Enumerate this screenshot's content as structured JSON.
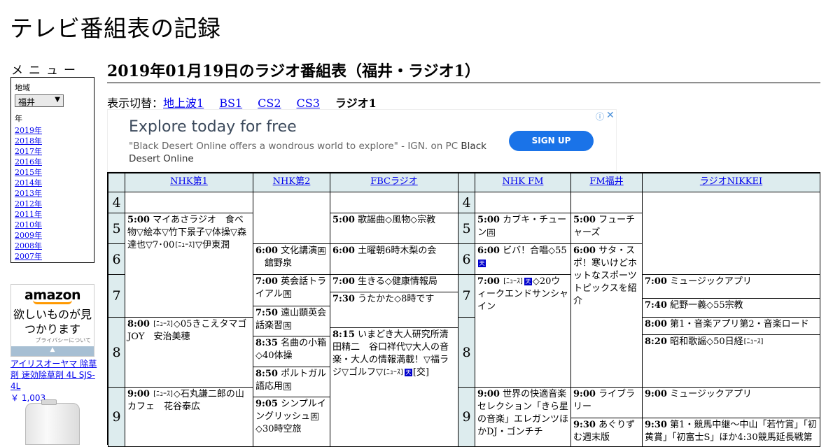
{
  "site_title": "テレビ番組表の記録",
  "menu": {
    "heading": "メニュー",
    "region_label": "地域",
    "region_value": "福井",
    "year_label": "年",
    "years": [
      "2019年",
      "2018年",
      "2017年",
      "2016年",
      "2015年",
      "2014年",
      "2013年",
      "2012年",
      "2011年",
      "2010年",
      "2009年",
      "2008年",
      "2007年"
    ]
  },
  "page_title": "2019年01月19日のラジオ番組表（福井・ラジオ1）",
  "switcher": {
    "label": "表示切替：",
    "links": [
      "地上波1",
      "BS1",
      "CS2",
      "CS3"
    ],
    "current": "ラジオ1"
  },
  "ad": {
    "headline": "Explore today for free",
    "body": "\"Black Desert Online offers a wondrous world to explore\" - IGN. on PC ",
    "advertiser": "Black Desert Online",
    "cta": "SIGN UP",
    "info_icon": "info-icon",
    "close_icon": "close-icon"
  },
  "amazon_ad": {
    "logo": "amazon",
    "message": "欲しいものが見つかります",
    "privacy": "プライバシーについて",
    "product": "アイリスオーヤマ 除草剤 速効除草剤 4L SJS-4L",
    "price": "￥ 1,003"
  },
  "channels": {
    "ch1": "NHK第1",
    "ch2": "NHK第2",
    "ch3": "FBCラジオ",
    "ch4": "NHK FM",
    "ch5": "FM福井",
    "ch6": "ラジオNIKKEI"
  },
  "hours": {
    "h4": "4",
    "h5": "5",
    "h6": "6",
    "h7": "7",
    "h8": "8",
    "h9": "9"
  },
  "programs": {
    "nhk1_0500": {
      "time": "5:00",
      "title": "マイあさラジオ　食べ物▽絵本▽竹下景子▽体操▽森達也▽7･00",
      "extra": "▽伊東潤"
    },
    "nhk1_0800": {
      "time": "8:00",
      "title": "◇05きこえタマゴJOY　安治美穂"
    },
    "nhk1_0900": {
      "time": "9:00",
      "title": "◇石丸謙二郎の山カフェ　花谷泰広"
    },
    "nhk2_0600": {
      "time": "6:00",
      "title": "文化講演",
      "extra": "舘野泉"
    },
    "nhk2_0700": {
      "time": "7:00",
      "title": "英会話トライアル"
    },
    "nhk2_0750": {
      "time": "7:50",
      "title": "遠山顕英会話楽習"
    },
    "nhk2_0835": {
      "time": "8:35",
      "title": "名曲の小箱◇40体操"
    },
    "nhk2_0850": {
      "time": "8:50",
      "title": "ポルトガル語応用"
    },
    "nhk2_0905": {
      "time": "9:05",
      "title": "シンプルイングリッシュ",
      "extra": "◇30時空旅"
    },
    "fbc_0500": {
      "time": "5:00",
      "title": "歌謡曲◇風物◇宗教"
    },
    "fbc_0600": {
      "time": "6:00",
      "title": "土曜朝6時木梨の会"
    },
    "fbc_0700": {
      "time": "7:00",
      "title": "生きる◇健康情報局"
    },
    "fbc_0730": {
      "time": "7:30",
      "title": "うたかた◇8時です"
    },
    "fbc_0815": {
      "time": "8:15",
      "title": "いまどき大人研究所清田精二　谷口祥代▽大人の音楽・大人の情報満載！▽福ラジ▽ゴルフ▽",
      "extra": "[交]"
    },
    "nhkfm_0500": {
      "time": "5:00",
      "title": "カブキ・チューン"
    },
    "nhkfm_0600": {
      "time": "6:00",
      "title": "ビバ！合唱◇55"
    },
    "nhkfm_0700": {
      "time": "7:00",
      "title": "◇20ウィークエンドサンシャイン"
    },
    "nhkfm_0900": {
      "time": "9:00",
      "title": "世界の快適音楽セレクション「きら星の音楽」エレガンツほかDJ・ゴンチチ"
    },
    "fmf_0500": {
      "time": "5:00",
      "title": "フューチャーズ"
    },
    "fmf_0600": {
      "time": "6:00",
      "title": "サタ・スポ！寒いけどホットなスポーツトピックスを紹介"
    },
    "fmf_0900": {
      "time": "9:00",
      "title": "ライブラリー"
    },
    "fmf_0930": {
      "time": "9:30",
      "title": "あぐりずむ週末版"
    },
    "nikkei_0700": {
      "time": "7:00",
      "title": "ミュージックアプリ"
    },
    "nikkei_0740": {
      "time": "7:40",
      "title": "紀野一義◇55宗教"
    },
    "nikkei_0800": {
      "time": "8:00",
      "title": "第1・音楽アプリ第2・音楽ロード"
    },
    "nikkei_0820": {
      "time": "8:20",
      "title": "昭和歌謡◇50日経"
    },
    "nikkei_0900": {
      "time": "9:00",
      "title": "ミュージックアプリ"
    },
    "nikkei_0930": {
      "time": "9:30",
      "title": "第1・競馬中継〜中山「若竹賞」「初黄賞」「初富士S」ほか4:30競馬延長戦第"
    }
  },
  "icons": {
    "news": "[ﾆｭｰｽ]",
    "re": "再",
    "sky": "天"
  }
}
